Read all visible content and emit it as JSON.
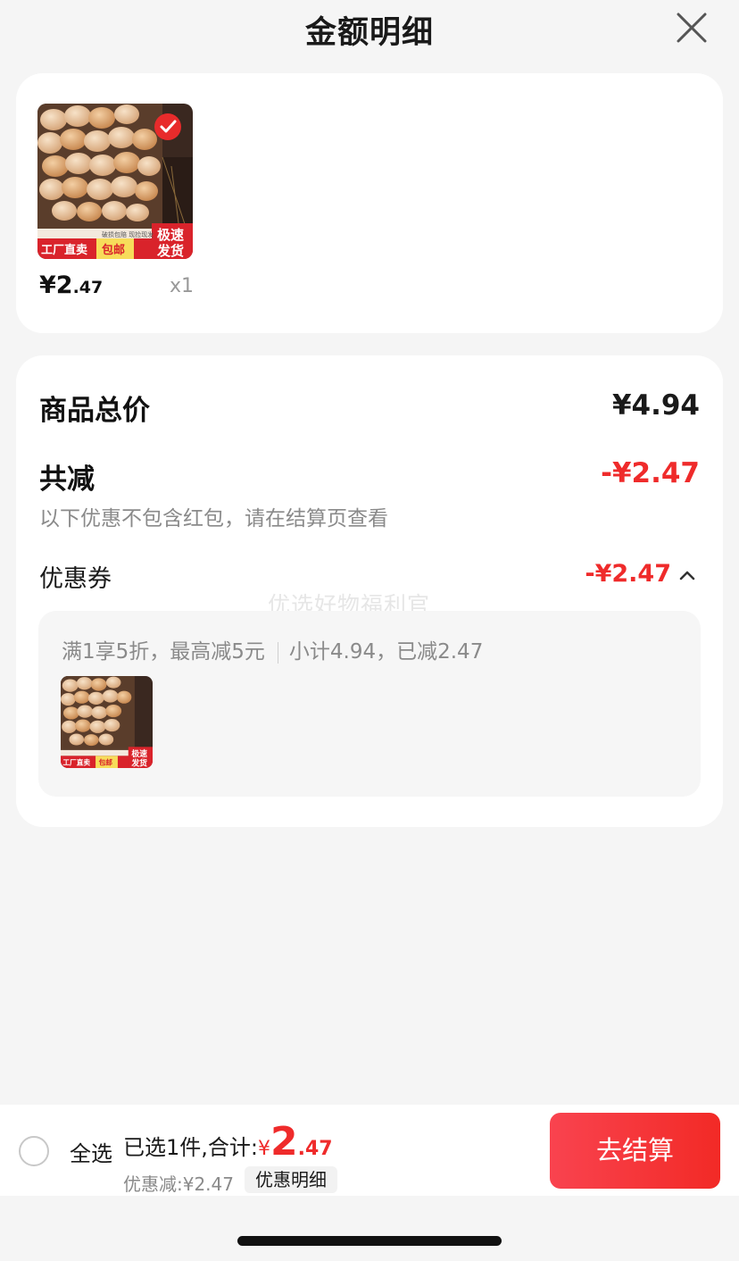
{
  "header": {
    "title": "金额明细"
  },
  "product": {
    "currency": "¥",
    "price_int": "2",
    "price_dec": ".47",
    "qty": "x1",
    "badges": {
      "tag1": "工厂直卖",
      "tag2": "包邮",
      "tag3": "极速",
      "tag4": "发货",
      "strip": "破损包赔  现捡现发"
    }
  },
  "totals": {
    "total_label": "商品总价",
    "total_value": "¥4.94",
    "reduce_label": "共减",
    "reduce_value": "-¥2.47",
    "note": "以下优惠不包含红包，请在结算页查看",
    "coupon_label": "优惠券",
    "coupon_value": "-¥2.47",
    "coupon_rule": "满1享5折，最高减5元",
    "coupon_subtotal": "小计4.94，已减2.47"
  },
  "watermark": "优选好物福利官",
  "bottom": {
    "select_all": "全选",
    "summary_prefix": "已选1件,合计:",
    "currency": "¥",
    "total_int": "2",
    "total_dec": ".47",
    "discount": "优惠减:¥2.47",
    "detail_link": "优惠明细",
    "checkout": "去结算"
  },
  "colors": {
    "accent_red": "#ef2b2b",
    "background": "#f5f5f5"
  }
}
